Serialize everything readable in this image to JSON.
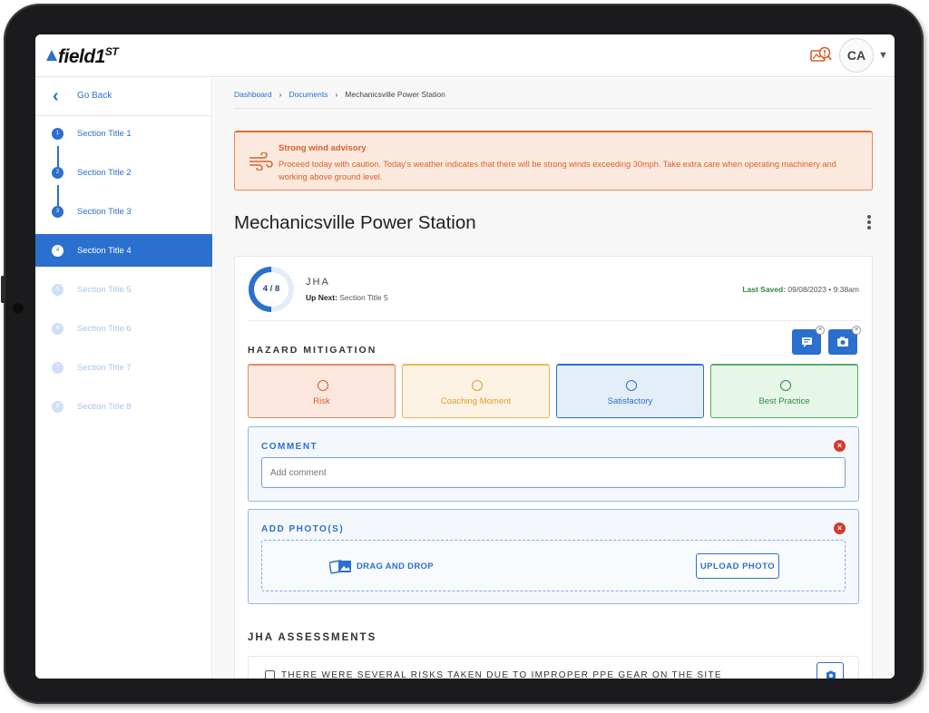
{
  "header": {
    "logo": "field1",
    "logo_sup": "ST",
    "avatar_initials": "CA",
    "alert_icon": "weather-alert-icon"
  },
  "sidebar": {
    "go_back": "Go Back",
    "sections": [
      {
        "num": "1",
        "label": "Section Title 1",
        "state": "done"
      },
      {
        "num": "2",
        "label": "Section Title 2",
        "state": "done"
      },
      {
        "num": "3",
        "label": "Section Title 3",
        "state": "done"
      },
      {
        "num": "4",
        "label": "Section Title 4",
        "state": "active"
      },
      {
        "num": "5",
        "label": "Section Title 5",
        "state": "upcoming"
      },
      {
        "num": "6",
        "label": "Section Title 6",
        "state": "upcoming"
      },
      {
        "num": "7",
        "label": "Section Title 7",
        "state": "upcoming"
      },
      {
        "num": "8",
        "label": "Section Title 8",
        "state": "upcoming"
      }
    ]
  },
  "breadcrumb": {
    "items": [
      "Dashboard",
      "Documents",
      "Mechanicsville Power Station"
    ]
  },
  "advisory": {
    "title": "Strong wind advisory",
    "body": "Proceed today with caution. Today's weather indicates that there will be strong winds exceeding 30mph. Take extra care when operating machinery and working above ground level."
  },
  "page": {
    "title": "Mechanicsville Power Station"
  },
  "progress": {
    "label": "4 / 8",
    "fraction": 0.5
  },
  "jha": {
    "name": "JHA",
    "up_next_label": "Up Next:",
    "up_next_value": "Section Title 5",
    "last_saved_label": "Last Saved:",
    "last_saved_value": "09/08/2023 • 9:38am"
  },
  "hazard": {
    "title": "HAZARD MITIGATION",
    "options": [
      "Risk",
      "Coaching Moment",
      "Satisfactory",
      "Best Practice"
    ]
  },
  "comment": {
    "title": "COMMENT",
    "placeholder": "Add comment"
  },
  "photos": {
    "title": "ADD PHOTO(S)",
    "drag_drop": "DRAG AND DROP",
    "upload": "UPLOAD PHOTO"
  },
  "assessments": {
    "title": "JHA ASSESSMENTS",
    "items": [
      "THERE WERE SEVERAL RISKS TAKEN DUE TO IMPROPER PPE GEAR ON THE SITE"
    ]
  },
  "colors": {
    "primary": "#2b6fcf",
    "warning": "#d8602b",
    "success": "#2d8a3e",
    "danger": "#d33a2c"
  }
}
